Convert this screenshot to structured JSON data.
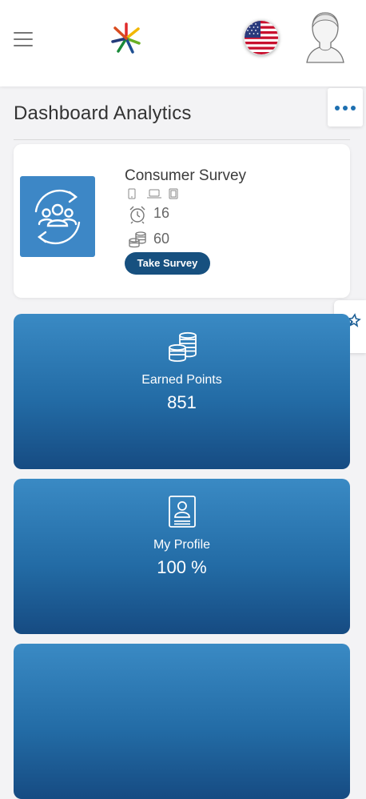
{
  "header": {
    "menu_icon": "hamburger-icon",
    "logo_icon": "brand-star-logo",
    "language_flag": "us-flag-icon",
    "user_avatar": "user-avatar-icon"
  },
  "page": {
    "title": "Dashboard Analytics",
    "more_icon": "ellipsis-icon",
    "wand_icon": "magic-wand-icon"
  },
  "survey": {
    "name": "Consumer Survey",
    "duration": "16",
    "points": "60",
    "button_label": "Take Survey",
    "device_icons": [
      "phone-icon",
      "laptop-icon",
      "tablet-icon"
    ]
  },
  "tiles": [
    {
      "label": "Earned Points",
      "value": "851",
      "icon": "coins-icon"
    },
    {
      "label": "My Profile",
      "value": "100 %",
      "icon": "profile-card-icon"
    }
  ],
  "colors": {
    "accent": "#1d6fb0",
    "button": "#17507f",
    "tile_top": "#3a8ac4",
    "tile_bottom": "#164b82"
  }
}
